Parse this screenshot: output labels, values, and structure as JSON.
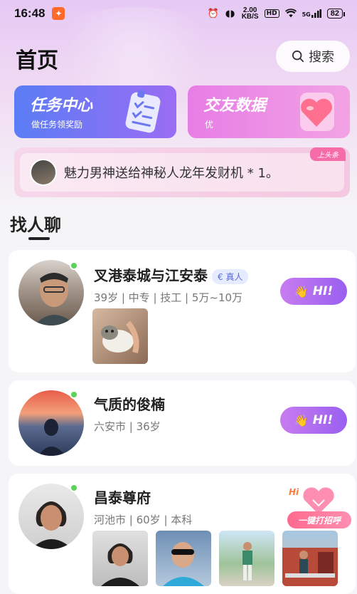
{
  "status": {
    "time": "16:48",
    "net_speed": "2.00",
    "net_unit": "KB/S",
    "hd": "HD",
    "signal": "5G",
    "battery": "82"
  },
  "header": {
    "title": "首页",
    "search_label": "搜索"
  },
  "cards": [
    {
      "title": "任务中心",
      "subtitle": "做任务领奖励"
    },
    {
      "title": "交友数据",
      "subtitle": "优"
    }
  ],
  "banner": {
    "message": "魅力男神送给神秘人龙年发财机 * 1。",
    "tag": "上头条"
  },
  "section": {
    "title": "找人聊"
  },
  "users": [
    {
      "name": "叉港泰城与江安泰",
      "badge": "真人",
      "info": "39岁 | 中专 | 技工 | 5万~10万",
      "hi": "HI!"
    },
    {
      "name": "气质的俊楠",
      "info": "六安市 | 36岁",
      "hi": "HI!"
    },
    {
      "name": "昌泰尊府",
      "info": "河池市 | 60岁 | 本科",
      "hi": "HI!"
    }
  ],
  "float_button": {
    "label": "一键打招呼",
    "hi_text": "Hi"
  },
  "colors": {
    "accent": "#9a5ff0",
    "online": "#5ad35a",
    "banner_tag": "#f56ca8"
  }
}
